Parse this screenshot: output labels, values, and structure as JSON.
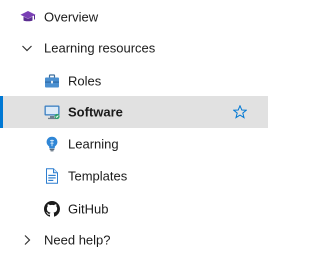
{
  "nav": {
    "overview": {
      "label": "Overview",
      "icon": "graduation-cap-icon"
    },
    "learning_resources": {
      "label": "Learning resources",
      "expanded": true,
      "items": [
        {
          "label": "Roles",
          "icon": "briefcase-icon"
        },
        {
          "label": "Software",
          "icon": "monitor-icon",
          "selected": true,
          "favorite_icon": "star-icon"
        },
        {
          "label": "Learning",
          "icon": "lightbulb-icon"
        },
        {
          "label": "Templates",
          "icon": "document-icon"
        },
        {
          "label": "GitHub",
          "icon": "github-icon"
        }
      ]
    },
    "need_help": {
      "label": "Need help?",
      "expanded": false
    }
  },
  "colors": {
    "accent": "#0078d4",
    "selected_background": "#e1e1e1",
    "text": "#1b1b1b",
    "overview_icon": "#7a3fb5"
  }
}
